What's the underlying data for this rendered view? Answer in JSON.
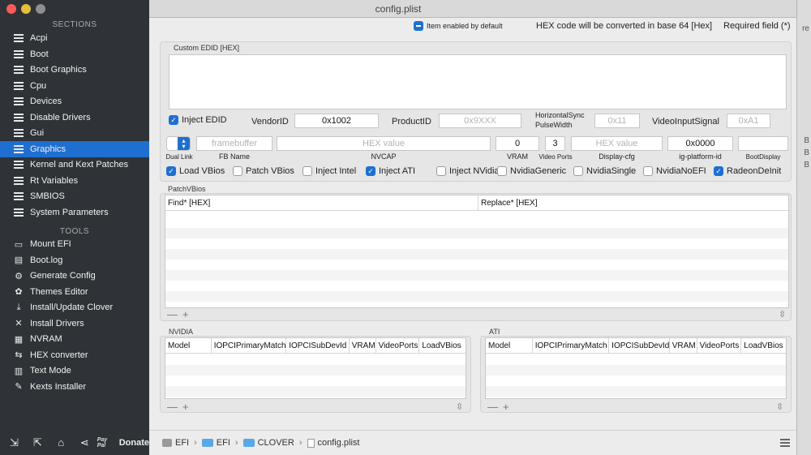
{
  "window": {
    "title": "config.plist"
  },
  "desktop_right": {
    "labels": [
      "re",
      "B",
      "B",
      "B"
    ]
  },
  "sidebar": {
    "sections_heading": "SECTIONS",
    "sections": [
      {
        "label": "Acpi"
      },
      {
        "label": "Boot"
      },
      {
        "label": "Boot Graphics"
      },
      {
        "label": "Cpu"
      },
      {
        "label": "Devices"
      },
      {
        "label": "Disable Drivers"
      },
      {
        "label": "Gui"
      },
      {
        "label": "Graphics"
      },
      {
        "label": "Kernel and Kext Patches"
      },
      {
        "label": "Rt Variables"
      },
      {
        "label": "SMBIOS"
      },
      {
        "label": "System Parameters"
      }
    ],
    "active_section": "Graphics",
    "tools_heading": "TOOLS",
    "tools": [
      {
        "label": "Mount EFI",
        "icon": "drive-icon"
      },
      {
        "label": "Boot.log",
        "icon": "document-icon"
      },
      {
        "label": "Generate Config",
        "icon": "gear-icon"
      },
      {
        "label": "Themes Editor",
        "icon": "palette-icon"
      },
      {
        "label": "Install/Update Clover",
        "icon": "download-icon"
      },
      {
        "label": "Install Drivers",
        "icon": "wrench-icon"
      },
      {
        "label": "NVRAM",
        "icon": "chip-icon"
      },
      {
        "label": "HEX converter",
        "icon": "convert-icon"
      },
      {
        "label": "Text Mode",
        "icon": "text-icon"
      },
      {
        "label": "Kexts Installer",
        "icon": "puzzle-icon"
      }
    ],
    "bottom": {
      "paypal": "Pay Pal",
      "donate": "Donate"
    }
  },
  "header": {
    "item_enabled": "Item enabled by default",
    "hex_note": "HEX code will be converted in base 64 [Hex]",
    "required_note": "Required field (*)"
  },
  "edid": {
    "group_label": "Custom EDID [HEX]",
    "inject_edid": {
      "label": "Inject EDID",
      "checked": true
    },
    "vendor_label": "VendorID",
    "vendor_value": "0x1002",
    "product_label": "ProductID",
    "product_placeholder": "0x9XXX",
    "hsync_label_1": "HorizontalSync",
    "hsync_label_2": "PulseWidth",
    "hsync_placeholder": "0x11",
    "vis_label": "VideoInputSignal",
    "vis_placeholder": "0xA1"
  },
  "fields": {
    "dual_link": "Dual Link",
    "fb_name": "FB Name",
    "fb_placeholder": "framebuffer",
    "nvcap": "NVCAP",
    "nvcap_placeholder": "HEX value",
    "vram": "VRAM",
    "vram_value": "0",
    "video_ports": "Video Ports",
    "video_ports_value": "3",
    "display_cfg": "Display-cfg",
    "display_cfg_placeholder": "HEX value",
    "ig_platform": "ig-platform-id",
    "ig_platform_value": "0x0000",
    "boot_display": "BootDisplay"
  },
  "checkboxes": [
    {
      "label": "Load VBios",
      "checked": true
    },
    {
      "label": "Patch VBios",
      "checked": false
    },
    {
      "label": "Inject Intel",
      "checked": false
    },
    {
      "label": "Inject ATI",
      "checked": true
    },
    {
      "label": "Inject NVidia",
      "checked": false
    },
    {
      "label": "NvidiaGeneric",
      "checked": false
    },
    {
      "label": "NvidiaSingle",
      "checked": false
    },
    {
      "label": "NvidiaNoEFI",
      "checked": false
    },
    {
      "label": "RadeonDeInit",
      "checked": true
    }
  ],
  "patch_vbios": {
    "label": "PatchVBios",
    "columns": [
      "Find* [HEX]",
      "Replace* [HEX]"
    ]
  },
  "nvidia": {
    "label": "NVIDIA",
    "columns": [
      "Model",
      "IOPCIPrimaryMatch",
      "IOPCISubDevId",
      "VRAM",
      "VideoPorts",
      "LoadVBios"
    ]
  },
  "ati": {
    "label": "ATI",
    "columns": [
      "Model",
      "IOPCIPrimaryMatch",
      "IOPCISubDevId",
      "VRAM",
      "VideoPorts",
      "LoadVBios"
    ]
  },
  "table_controls": {
    "minus": "—",
    "plus": "+"
  },
  "pathbar": [
    "EFI",
    "EFI",
    "CLOVER",
    "config.plist"
  ],
  "colors": {
    "accent": "#1f6fd1",
    "sidebar_bg": "#2f3337"
  }
}
